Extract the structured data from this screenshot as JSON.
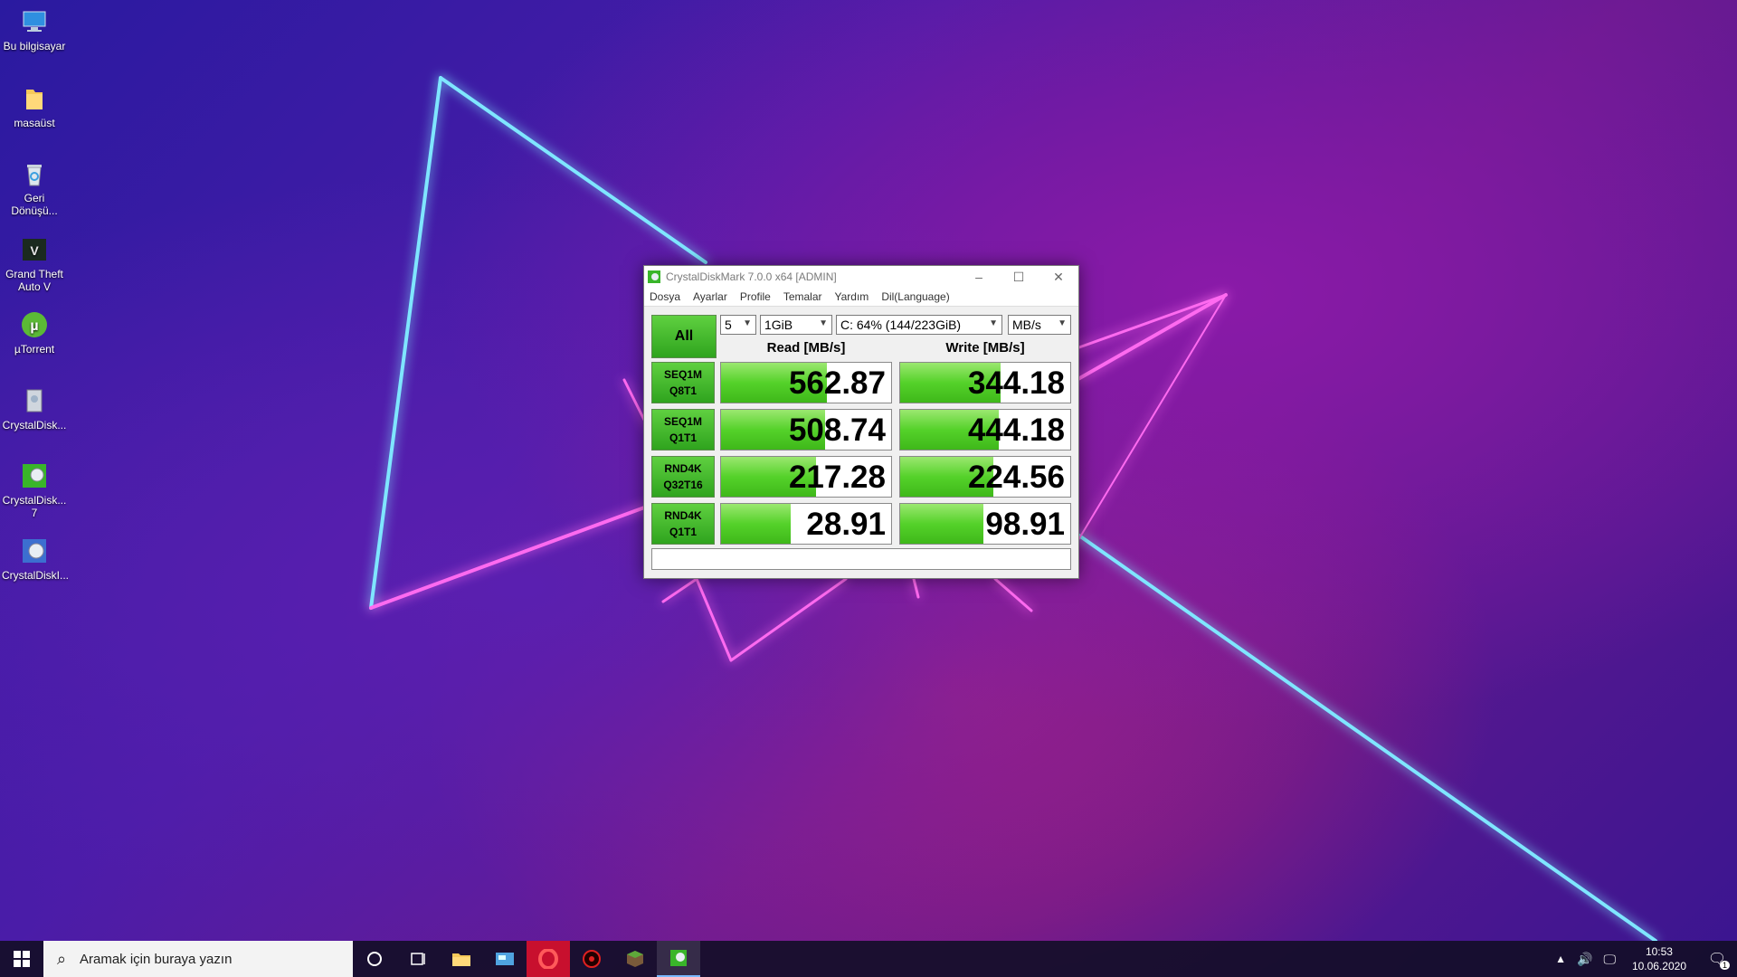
{
  "desktop": {
    "icons": [
      {
        "label": "Bu bilgisayar",
        "icon": "computer-icon"
      },
      {
        "label": "masaüst",
        "icon": "folder-icon"
      },
      {
        "label": "Geri Dönüşü...",
        "icon": "recycle-bin-icon"
      },
      {
        "label": "Grand Theft Auto V",
        "icon": "gta-icon"
      },
      {
        "label": "µTorrent",
        "icon": "utorrent-icon"
      },
      {
        "label": "CrystalDisk...",
        "icon": "crystaldiskinfo-icon"
      },
      {
        "label": "CrystalDisk... 7",
        "icon": "crystaldiskmark-icon"
      },
      {
        "label": "CrystalDiskI...",
        "icon": "crystaldiskinfo-shortcut-icon"
      }
    ]
  },
  "window": {
    "title": "CrystalDiskMark 7.0.0 x64 [ADMIN]",
    "menu": [
      "Dosya",
      "Ayarlar",
      "Profile",
      "Temalar",
      "Yardım",
      "Dil(Language)"
    ],
    "all_label": "All",
    "count_value": "5",
    "size_value": "1GiB",
    "drive_value": "C: 64% (144/223GiB)",
    "unit_value": "MB/s",
    "read_header": "Read [MB/s]",
    "write_header": "Write [MB/s]",
    "accent_color": "#3fb81a",
    "rows": [
      {
        "line1": "SEQ1M",
        "line2": "Q8T1",
        "read": "562.87",
        "write": "344.18",
        "read_fill": 0.62,
        "write_fill": 0.59
      },
      {
        "line1": "SEQ1M",
        "line2": "Q1T1",
        "read": "508.74",
        "write": "444.18",
        "read_fill": 0.61,
        "write_fill": 0.58
      },
      {
        "line1": "RND4K",
        "line2": "Q32T16",
        "read": "217.28",
        "write": "224.56",
        "read_fill": 0.56,
        "write_fill": 0.55
      },
      {
        "line1": "RND4K",
        "line2": "Q1T1",
        "read": "28.91",
        "write": "98.91",
        "read_fill": 0.41,
        "write_fill": 0.49
      }
    ],
    "status_text": ""
  },
  "taskbar": {
    "search_placeholder": "Aramak için buraya yazın",
    "apps": [
      "cortana-icon",
      "task-view-icon",
      "file-explorer-icon",
      "control-panel-icon",
      "opera-icon",
      "game-icon",
      "minecraft-icon",
      "crystaldiskmark-taskbar-icon"
    ],
    "time": "10:53",
    "date": "10.06.2020",
    "notification_count": "1"
  }
}
